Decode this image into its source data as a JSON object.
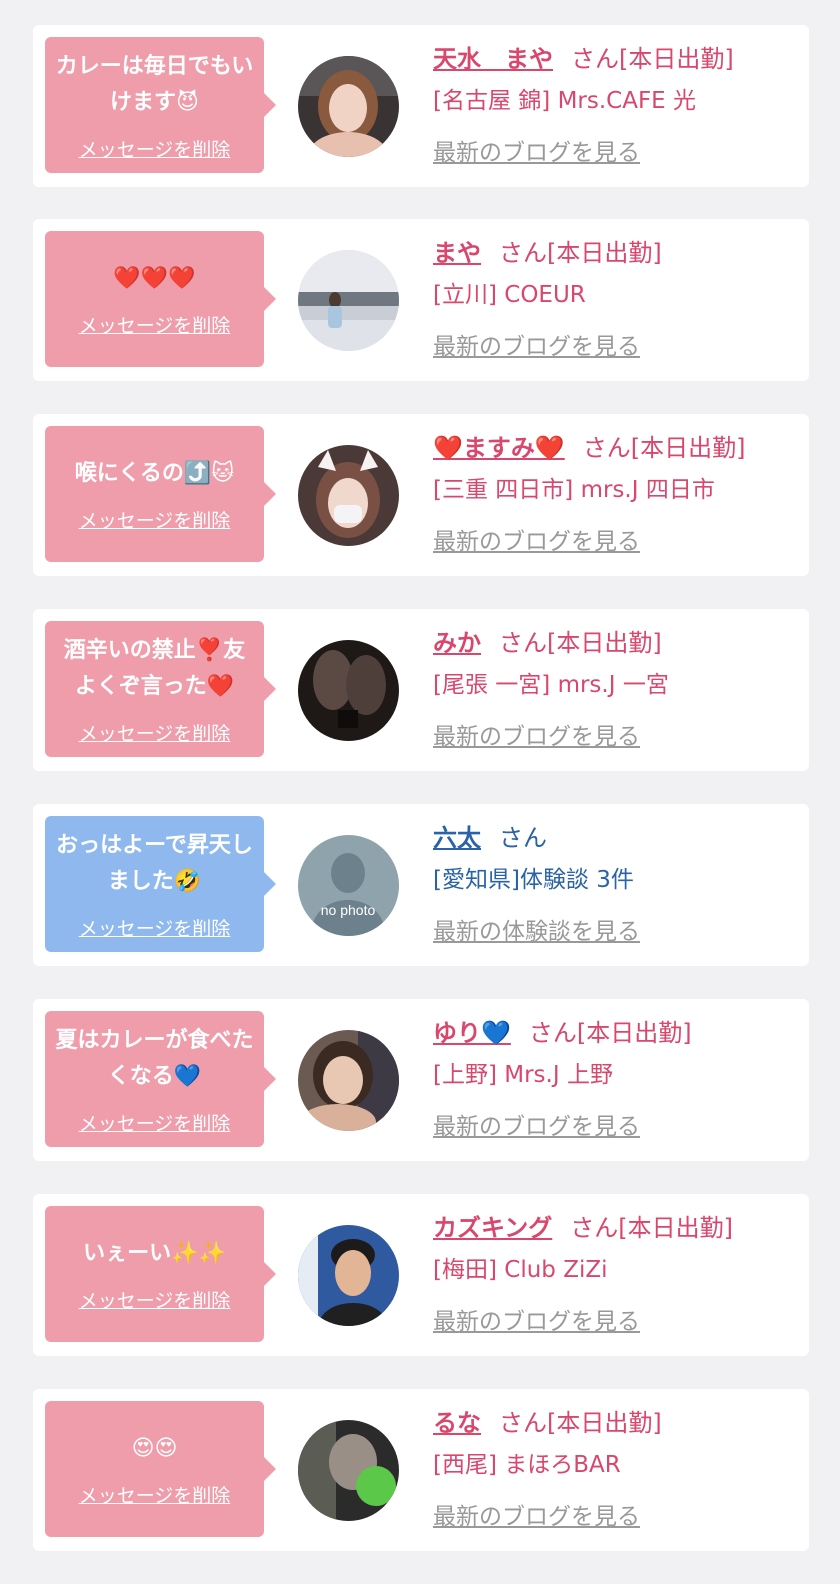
{
  "delete_label": "メッセージを削除",
  "colors": {
    "page_bg": "#f1f1f3",
    "pink_bubble": "#ef9daa",
    "blue_bubble": "#8fb9ee",
    "pink_text": "#d9476d",
    "blue_text": "#2a63a8",
    "link_gray": "#999999"
  },
  "cards": [
    {
      "message": "カレーは毎日でもいけます😈",
      "name": "天水　まや",
      "suffix": "さん[本日出勤]",
      "shop": "[名古屋 錦] Mrs.CAFE 光",
      "more_link": "最新のブログを見る",
      "avatar": "woman-selfie-photo"
    },
    {
      "message": "❤️❤️❤️",
      "name": "まや",
      "suffix": "さん[本日出勤]",
      "shop": "[立川] COEUR",
      "more_link": "最新のブログを見る",
      "avatar": "woman-seaside-photo"
    },
    {
      "message": "喉にくるの⤴️🐱",
      "name": "❤️ますみ❤️",
      "suffix": "さん[本日出勤]",
      "shop": "[三重 四日市] mrs.J 四日市",
      "more_link": "最新のブログを見る",
      "avatar": "woman-cat-ears-photo"
    },
    {
      "message": "酒辛いの禁止❣️友よくぞ言った❤️",
      "name": "みか",
      "suffix": "さん[本日出勤]",
      "shop": "[尾張 一宮] mrs.J 一宮",
      "more_link": "最新のブログを見る",
      "avatar": "stockings-legs-photo"
    },
    {
      "message": "おっはよーで昇天しました🤣",
      "name": "六太",
      "suffix": "さん",
      "shop": "[愛知県]体験談 3件",
      "more_link": "最新の体験談を見る",
      "avatar": "no-photo-placeholder",
      "avatar_text": "no photo"
    },
    {
      "message": "夏はカレーが食べたくなる💙",
      "name": "ゆり💙",
      "suffix": "さん[本日出勤]",
      "shop": "[上野] Mrs.J 上野",
      "more_link": "最新のブログを見る",
      "avatar": "woman-smiling-photo"
    },
    {
      "message": "いぇーい✨✨",
      "name": "カズキング",
      "suffix": "さん[本日出勤]",
      "shop": "[梅田] Club ZiZi",
      "more_link": "最新のブログを見る",
      "avatar": "man-portrait-photo"
    },
    {
      "message": "😍😍",
      "name": "るな",
      "suffix": "さん[本日出勤]",
      "shop": "[西尾] まほろBAR",
      "more_link": "最新のブログを見る",
      "avatar": "woman-mask-photo"
    }
  ]
}
